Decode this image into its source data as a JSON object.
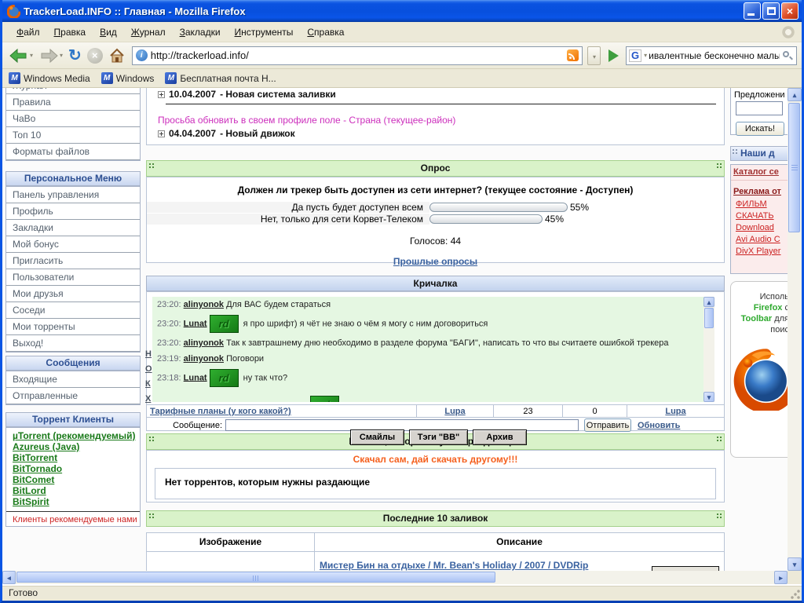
{
  "window": {
    "title": "TrackerLoad.INFO :: Главная - Mozilla Firefox"
  },
  "menubar": {
    "items": [
      {
        "label": "Файл"
      },
      {
        "label": "Правка"
      },
      {
        "label": "Вид"
      },
      {
        "label": "Журнал"
      },
      {
        "label": "Закладки"
      },
      {
        "label": "Инструменты"
      },
      {
        "label": "Справка"
      }
    ]
  },
  "navbar": {
    "url": "http://trackerload.info/",
    "search_value": "ивалентные бесконечно малые",
    "search_engine_letter": "G"
  },
  "bookmarks": {
    "icon_letter": "M",
    "items": [
      {
        "label": "Windows Media"
      },
      {
        "label": "Windows"
      },
      {
        "label": "Бесплатная почта Н..."
      }
    ]
  },
  "sidebar": {
    "nav": {
      "items": [
        {
          "label": "Журнал"
        },
        {
          "label": "Правила"
        },
        {
          "label": "ЧаВо"
        },
        {
          "label": "Топ 10"
        },
        {
          "label": "Форматы файлов"
        }
      ]
    },
    "personal": {
      "title": "Персональное Меню",
      "items": [
        {
          "label": "Панель управления"
        },
        {
          "label": "Профиль"
        },
        {
          "label": "Закладки"
        },
        {
          "label": "Мой бонус"
        },
        {
          "label": "Пригласить"
        },
        {
          "label": "Пользователи"
        },
        {
          "label": "Мои друзья"
        },
        {
          "label": "Соседи"
        },
        {
          "label": "Мои торренты"
        },
        {
          "label": "Выход!"
        }
      ]
    },
    "messages": {
      "title": "Сообщения",
      "items": [
        {
          "label": "Входящие"
        },
        {
          "label": "Отправленные"
        }
      ]
    },
    "clients": {
      "title": "Торрент Клиенты",
      "items": [
        {
          "label": "µTorrent (рекомендуемый)"
        },
        {
          "label": "Azureus (Java)"
        },
        {
          "label": "BitTorrent"
        },
        {
          "label": "BitTornado"
        },
        {
          "label": "BitComet"
        },
        {
          "label": "BitLord"
        },
        {
          "label": "BitSpirit"
        }
      ],
      "note": "Клиенты рекомендуемые нами"
    }
  },
  "news": {
    "item1_date": "10.04.2007",
    "item1_title": "- Новая система заливки",
    "notice": "Просьба обновить в своем профиле поле - Страна (текущее-район)",
    "item2_date": "04.04.2007",
    "item2_title": "- Новый движок"
  },
  "poll": {
    "title": "Опрос",
    "question": "Должен ли трекер быть доступен из сети интернет? (текущее состояние - Доступен)",
    "options": [
      {
        "label": "Да пусть будет доступен всем",
        "percent": "55%",
        "value": 55
      },
      {
        "label": "Нет, только для сети Корвет-Телеком",
        "percent": "45%",
        "value": 45
      }
    ],
    "votes": "Голосов: 44",
    "archive": "Прошлые опросы"
  },
  "shoutbox": {
    "title": "Кричалка",
    "rd_badge_label": "rd",
    "messages": [
      {
        "time": "23:20:",
        "user": "alinyonok",
        "text": "Для ВАС будем стараться",
        "badge": false
      },
      {
        "time": "23:20:",
        "user": "Lunat",
        "text": "я про шрифт) я чёт не знаю о чём я могу с ним договориться",
        "badge": true
      },
      {
        "time": "23:20:",
        "user": "alinyonok",
        "text": "Так к завтрашнему дню необходимо в разделе форума \"БАГИ\", написать то что вы считаете ошибкой трекера",
        "badge": false
      },
      {
        "time": "23:19:",
        "user": "alinyonok",
        "text": "Поговори",
        "badge": false
      },
      {
        "time": "23:18:",
        "user": "Lunat",
        "text": "ну так что?",
        "badge": true
      }
    ],
    "edge_letters": [
      {
        "ch": "Н"
      },
      {
        "ch": "О"
      },
      {
        "ch": "К"
      },
      {
        "ch": "Х"
      }
    ],
    "topic": {
      "name": "Тарифные планы (у кого какой?)",
      "col2": "Lupa",
      "col3": "23",
      "col4": "0",
      "col5": "Lupa"
    },
    "message_label": "Сообщение:",
    "send": "Отправить",
    "refresh": "Обновить",
    "tools": [
      {
        "label": "Смайлы"
      },
      {
        "label": "Тэги \"BB\""
      },
      {
        "label": "Архив"
      }
    ]
  },
  "releases": {
    "title": "Релизы, которым нужны раздающие",
    "motto": "Скачал сам, дай скачать другому!!!",
    "empty": "Нет торрентов, которым нужны раздающие"
  },
  "latest": {
    "title": "Последние 10 заливок",
    "col_image": "Изображение",
    "col_desc": "Описание",
    "rows": [
      {
        "description": "Мистер Бин на отдыхе / Mr. Bean's Holiday / 2007 / DVDRip"
      }
    ]
  },
  "rightbar": {
    "suggest_label": "Предложени",
    "search_button": "Искать!",
    "partners_title": "Наши д",
    "catalog_link": "Каталог се",
    "ads_title": "Реклама от",
    "ad_links": [
      {
        "label": "ФИЛЬМ"
      },
      {
        "label": "СКАЧАТЬ"
      },
      {
        "label": "Download"
      },
      {
        "label": "Avi Audio C"
      },
      {
        "label": "DivX Player"
      }
    ],
    "promo": {
      "t1": "Исполь",
      "t2": "Firefox",
      "t2b": " с",
      "t3": "Toolbar",
      "t3b": " для",
      "t4": "поис"
    }
  },
  "statusbar": {
    "text": "Готово"
  }
}
